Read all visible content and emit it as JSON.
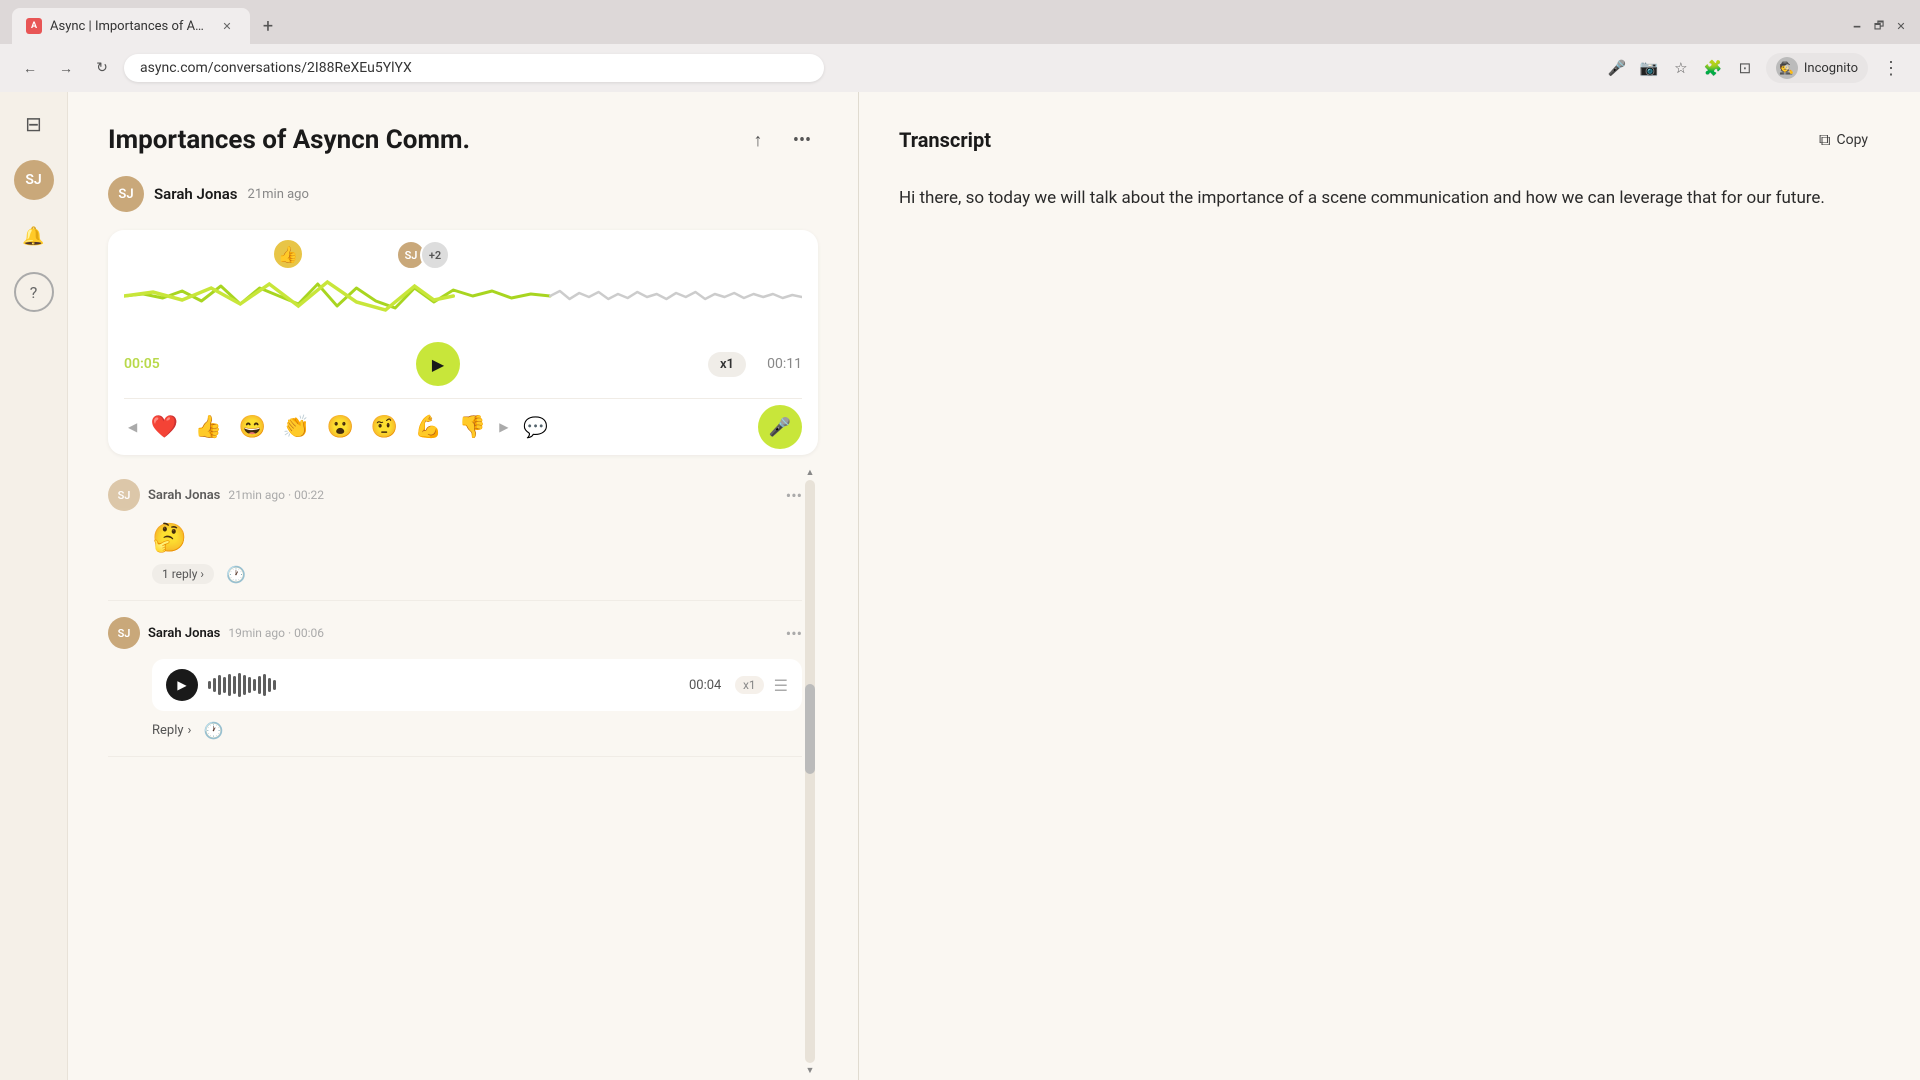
{
  "browser": {
    "tab_title": "Async | Importances of Asynco Co...",
    "tab_favicon": "A",
    "url": "async.com/conversations/2I88ReXEu5YlYX",
    "incognito_label": "Incognito"
  },
  "sidebar": {
    "icons": [
      "sidebar-toggle",
      "user-avatar",
      "bell",
      "help"
    ]
  },
  "conversation": {
    "title": "Importances of Asyncn Comm.",
    "author": "Sarah Jonas",
    "time_ago": "21min ago",
    "current_time": "00:05",
    "total_time": "00:11",
    "speed": "x1",
    "emojis": [
      "❤️",
      "👍",
      "😄",
      "👏",
      "😮",
      "🤨",
      "💪",
      "👎"
    ],
    "reaction_emoji": "👍"
  },
  "comments": [
    {
      "author": "Sarah Jonas",
      "time": "21min ago",
      "duration": "00:22",
      "emoji": "🤔",
      "reply_count": "1 reply",
      "has_audio": false
    },
    {
      "author": "Sarah Jonas",
      "time": "19min ago",
      "duration": "00:06",
      "has_audio": true,
      "audio_time": "00:04",
      "audio_speed": "x1",
      "reply_label": "Reply"
    }
  ],
  "transcript": {
    "title": "Transcript",
    "copy_label": "Copy",
    "text": "Hi there, so today we will talk about the importance of a scene communication and how we can leverage that for our future."
  }
}
